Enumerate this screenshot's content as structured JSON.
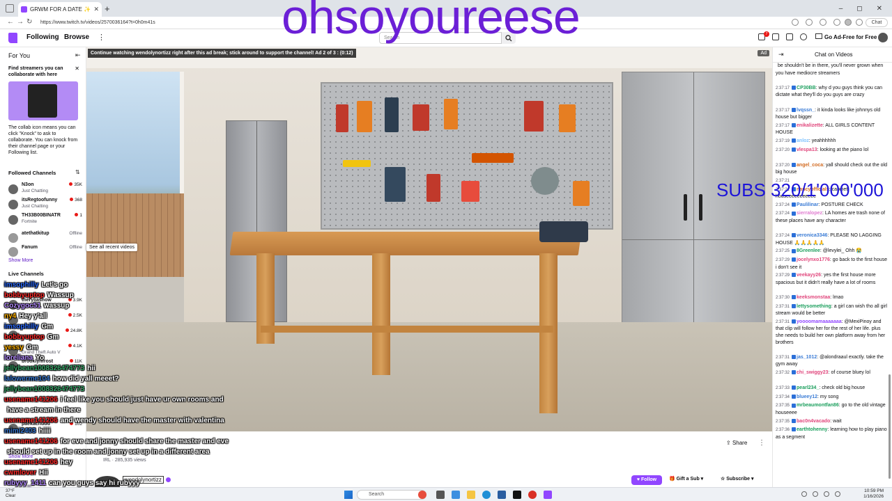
{
  "overlay_title": "ohsoyoureese",
  "subs_counter": "SUBS 320/1'000'000",
  "browser": {
    "tab_title": "GRWM FOR A DATE ✨ ☕",
    "url": "https://www.twitch.tv/videos/2570036164?t=0h0m41s",
    "chat_pill": "Chat",
    "window_controls": [
      "–",
      "◻",
      "✕"
    ]
  },
  "topnav": {
    "following": "Following",
    "browse": "Browse",
    "search_placeholder": "Search",
    "notification_count": "7",
    "ad_free": "Go Ad-Free for Free"
  },
  "sidebar": {
    "title": "For You",
    "promo_heading": "Find streamers you can collaborate with here",
    "promo_body": "The collab icon means you can click \"Knock\" to ask to collaborate. You can knock from their channel page or your Following list.",
    "followed_heading": "Followed Channels",
    "followed": [
      {
        "name": "N3on",
        "category": "Just Chatting",
        "viewers": "35K"
      },
      {
        "name": "itsRegtoofunny",
        "category": "Just Chatting",
        "viewers": "368"
      },
      {
        "name": "TH33B00BINATR",
        "category": "Fortnite",
        "viewers": "1"
      },
      {
        "name": "atethatkitup",
        "category": "",
        "status": "Offline"
      },
      {
        "name": "Fanum",
        "category": "",
        "status": "Offline"
      }
    ],
    "show_more": "Show More",
    "tooltip": "See all recent videos",
    "live_heading": "Live Channels",
    "live": [
      {
        "name": "theryliashow",
        "viewers": "3.9K"
      },
      {
        "name": "",
        "viewers": "2.5K"
      },
      {
        "name": "",
        "viewers": "24.8K"
      },
      {
        "name": "",
        "category": "Grand Theft Auto V",
        "viewers": "4.1K"
      },
      {
        "name": "brooklynfrost",
        "viewers": "11K"
      },
      {
        "name": "paekachuuu",
        "viewers": "102"
      }
    ],
    "show_more_2": "Show More"
  },
  "video": {
    "ad_banner": "Continue watching wendolynortizz right after this ad break; stick around to support the channel! Ad 2 of 3 : (0:12)",
    "ad_tag": "Ad"
  },
  "chat_overlay": [
    {
      "user": "imsophilly",
      "msg": "Let's go",
      "color": "#2c6bff"
    },
    {
      "user": "bobbyuptop",
      "msg": "Wassup",
      "color": "#ff2a2a"
    },
    {
      "user": "Cozygoc51",
      "msg": "wassup",
      "color": "#b58cff"
    },
    {
      "user": "ny4",
      "msg": "Hey y'all",
      "color": "#ffb000"
    },
    {
      "user": "imsophilly",
      "msg": "Gm",
      "color": "#2c6bff"
    },
    {
      "user": "bobbyuptop",
      "msg": "Gm",
      "color": "#ff2a2a"
    },
    {
      "user": "yessy",
      "msg": "Gm",
      "color": "#ffb000"
    },
    {
      "user": "loreliana",
      "msg": "Yo",
      "color": "#b58cff"
    },
    {
      "user": "jellybean1008326474773",
      "msg": "hii",
      "color": "#3aa86b"
    },
    {
      "user": "lalowerme104",
      "msg": "how did yall meeet?",
      "color": "#3a7bd5"
    },
    {
      "user": "jellybean1008326474773",
      "msg": "",
      "color": "#3aa86b"
    },
    {
      "user": "usename141206",
      "msg": "i feel like you should just have ur own rooms and",
      "color": "#ff2a2a"
    },
    {
      "user": "",
      "msg": "have a stream in there",
      "color": "#ffffff"
    },
    {
      "user": "usename141206",
      "msg": "and wendy should have the master with valentina",
      "color": "#ff2a2a"
    },
    {
      "user": "mimi2403",
      "msg": "hiiii",
      "color": "#3a7bd5"
    },
    {
      "user": "usename141206",
      "msg": "for eve and jonny should share the master and eve",
      "color": "#ff2a2a"
    },
    {
      "user": "",
      "msg": "should set up in the room and jonny set up in a different area",
      "color": "#ffffff"
    },
    {
      "user": "usename141206",
      "msg": "hey",
      "color": "#ff2a2a"
    },
    {
      "user": "cwmlover",
      "msg": "Hii",
      "color": "#ff2a2a"
    },
    {
      "user": "rubyyy_1411",
      "msg": "can you guys say hi rubyyy",
      "color": "#b58cff"
    }
  ],
  "info": {
    "share": "Share",
    "views": "IRL · 285,935 views",
    "streamer": "wendolynortizz",
    "follow": "Follow",
    "gift_sub": "Gift a Sub",
    "subscribe": "Subscribe"
  },
  "chatpanel": {
    "title": "Chat on Videos",
    "messages": [
      {
        "time": "",
        "user": "",
        "color": "#0e0e10",
        "text": "be shouldn't be in there, you'll never grown when you have mediocre streamers"
      },
      {
        "time": "2:37:17",
        "user": "CP30BB",
        "color": "#1a9e5c",
        "text": ": why d you guys think you can dictate what they'll do you guys are crazy"
      },
      {
        "time": "2:37:17",
        "user": "lvqssn_",
        "color": "#3a7bd5",
        "text": ": it kinda looks like johnnys old house but bigger"
      },
      {
        "time": "2:37:17",
        "user": "enikalizette",
        "color": "#e0457b",
        "text": ": ALL GIRLS CONTENT HOUSE"
      },
      {
        "time": "2:37:19",
        "user": "anloz",
        "color": "#7ec3ff",
        "text": ": yeahhhhhh"
      },
      {
        "time": "2:37:20",
        "user": "vlespa13",
        "color": "#e0457b",
        "text": ": looking at the piano lol"
      },
      {
        "time": "2:37:20",
        "user": "angel_coca",
        "color": "#d2691e",
        "text": ": yall should check out the old big house"
      },
      {
        "time": "2:37:21",
        "user": "",
        "color": "#0e0e10",
        "text": ""
      },
      {
        "time": "2:37:21",
        "user": "nancyofficials",
        "color": "#d2691e",
        "text": ": cabinet houseeeeeeeeeee"
      },
      {
        "time": "2:37:24",
        "user": "Paulilinar",
        "color": "#3a7bd5",
        "text": ": POSTURE CHECK"
      },
      {
        "time": "2:37:24",
        "user": "sierralopez",
        "color": "#e07bd0",
        "text": ": LA homes are trash none of these places have any character"
      },
      {
        "time": "2:37:24",
        "user": "veronica3346",
        "color": "#3a7bd5",
        "text": ": PLEASE NO LAGGING HOUSE 🙏🙏🙏🙏🙏"
      },
      {
        "time": "2:37:25",
        "user": "8Greenlee",
        "color": "#1a9e5c",
        "text": ": @levylei_ Ohh 😭"
      },
      {
        "time": "2:37:29",
        "user": "jocelynxo1776",
        "color": "#e0457b",
        "text": ": go back to the first house i don't see it"
      },
      {
        "time": "2:37:29",
        "user": "veekayy26",
        "color": "#e0457b",
        "text": ": yes the first house more spacious but it didn't really have a lot of rooms"
      },
      {
        "time": "2:37:30",
        "user": "keeksmonstaa",
        "color": "#e0457b",
        "text": ": lmao"
      },
      {
        "time": "2:37:31",
        "user": "lettysomething",
        "color": "#1a9e5c",
        "text": ": a girl can wish tho all girl stream would be better"
      },
      {
        "time": "2:37:31",
        "user": "yoooomamaaaaaaa",
        "color": "#9146ff",
        "text": ": @MexiPinoy and that clip will follow her for the rest of her life. plus she needs to build her own platform away from her brothers"
      },
      {
        "time": "2:37:31",
        "user": "jas_1012",
        "color": "#3a7bd5",
        "text": ": @alondraaul exactly. take the gym away"
      },
      {
        "time": "2:37:32",
        "user": "chi_swiggy23",
        "color": "#e0457b",
        "text": ": of course bluey lol"
      },
      {
        "time": "2:37:33",
        "user": "pearl234_",
        "color": "#1a9e5c",
        "text": ": check old big house"
      },
      {
        "time": "2:37:34",
        "user": "blueey12",
        "color": "#3a7bd5",
        "text": ": my song"
      },
      {
        "time": "2:37:35",
        "user": "mrbeaumontfan86",
        "color": "#1a9e5c",
        "text": ": go to the old vintage houseeee"
      },
      {
        "time": "2:37:35",
        "user": "bac0n4vacado",
        "color": "#e0457b",
        "text": ": wait"
      },
      {
        "time": "2:37:36",
        "user": "earthtohenny",
        "color": "#1a9e5c",
        "text": ": learning how to play piano as a segment"
      }
    ]
  },
  "taskbar": {
    "weather_temp": "37°F",
    "weather_desc": "Clear",
    "search": "Search",
    "time": "10:59 PM",
    "date": "1/16/2026"
  }
}
